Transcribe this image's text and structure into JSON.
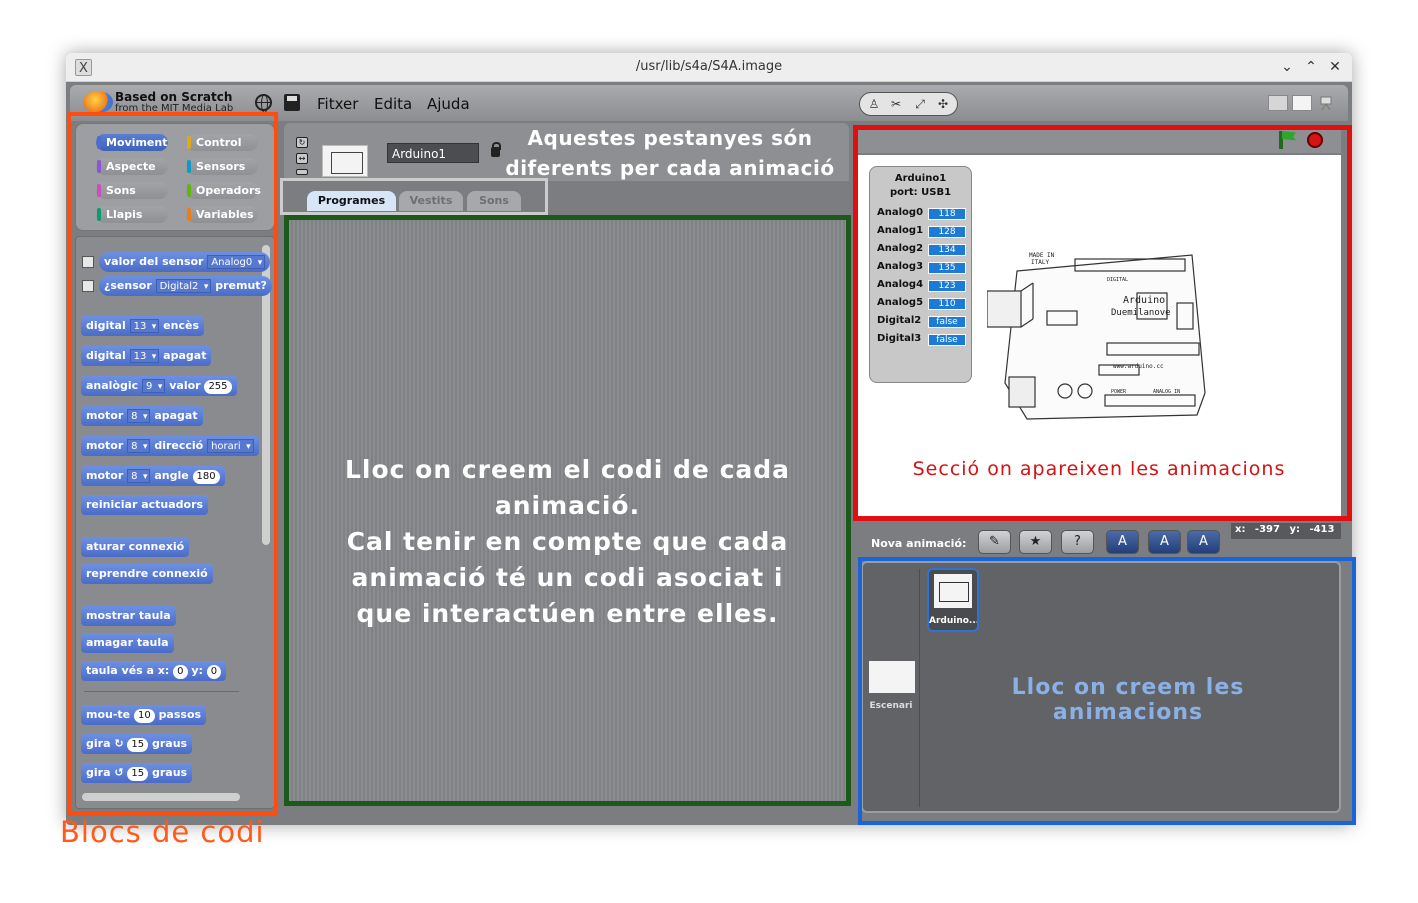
{
  "window": {
    "title": "/usr/lib/s4a/S4A.image",
    "app_icon": "X",
    "controls": [
      "chevron-down-icon",
      "chevron-up-icon",
      "close-icon"
    ]
  },
  "toolbar": {
    "brand_line1": "Based on Scratch",
    "brand_line2": "from the MIT Media Lab",
    "menus": [
      "Fitxer",
      "Edita",
      "Ajuda"
    ]
  },
  "categories": [
    {
      "label": "Moviment",
      "color": "#4a6cd4",
      "selected": true
    },
    {
      "label": "Control",
      "color": "#e1a91a",
      "selected": false
    },
    {
      "label": "Aspecte",
      "color": "#8a55d7",
      "selected": false
    },
    {
      "label": "Sensors",
      "color": "#0e9ac9",
      "selected": false
    },
    {
      "label": "Sons",
      "color": "#c94fc0",
      "selected": false
    },
    {
      "label": "Operadors",
      "color": "#5cb712",
      "selected": false
    },
    {
      "label": "Llapis",
      "color": "#0e9a6c",
      "selected": false
    },
    {
      "label": "Variables",
      "color": "#ee7d16",
      "selected": false
    }
  ],
  "blocks": {
    "sensor_value": {
      "text": "valor del sensor",
      "option": "Analog0"
    },
    "sensor_pressed": {
      "prefix": "¿sensor",
      "option": "Digital2",
      "suffix": "premut?"
    },
    "digital_on": {
      "prefix": "digital",
      "pin": "13",
      "suffix": "encès"
    },
    "digital_off": {
      "prefix": "digital",
      "pin": "13",
      "suffix": "apagat"
    },
    "analog": {
      "prefix": "analògic",
      "pin": "9",
      "mid": "valor",
      "value": "255"
    },
    "motor_off": {
      "prefix": "motor",
      "pin": "8",
      "suffix": "apagat"
    },
    "motor_dir": {
      "prefix": "motor",
      "pin": "8",
      "mid": "direcció",
      "option": "horari"
    },
    "motor_angle": {
      "prefix": "motor",
      "pin": "8",
      "mid": "angle",
      "value": "180"
    },
    "reset": "reiniciar actuadors",
    "stop_conn": "aturar connexió",
    "resume_conn": "reprendre connexió",
    "show_board": "mostrar taula",
    "hide_board": "amagar taula",
    "board_goto": {
      "prefix": "taula vés a x:",
      "x": "0",
      "ymid": "y:",
      "y": "0"
    },
    "move": {
      "prefix": "mou-te",
      "value": "10",
      "suffix": "passos"
    },
    "turn_cw": {
      "prefix": "gira",
      "value": "15",
      "suffix": "graus"
    },
    "turn_ccw": {
      "prefix": "gira",
      "value": "15",
      "suffix": "graus"
    }
  },
  "sprite": {
    "name": "Arduino1"
  },
  "tabs": [
    {
      "label": "Programes",
      "active": true
    },
    {
      "label": "Vestits",
      "active": false
    },
    {
      "label": "Sons",
      "active": false
    }
  ],
  "annotations": {
    "tabs_note_line1": "Aquestes pestanyes són",
    "tabs_note_line2": "diferents per cada animació",
    "scripts_note": [
      "Lloc on creem el codi de cada",
      "animació.",
      "Cal tenir en compte que cada",
      "animació té un codi asociat i",
      "que interactúen entre elles."
    ],
    "stage_note": "Secció on apareixen les animacions",
    "corral_note": "Lloc on creem les animacions",
    "blocks_note": "Blocs de codi"
  },
  "board_watcher": {
    "title_line1": "Arduino1",
    "title_line2": "port: USB1",
    "rows": [
      {
        "label": "Analog0",
        "value": "118"
      },
      {
        "label": "Analog1",
        "value": "128"
      },
      {
        "label": "Analog2",
        "value": "134"
      },
      {
        "label": "Analog3",
        "value": "135"
      },
      {
        "label": "Analog4",
        "value": "123"
      },
      {
        "label": "Analog5",
        "value": "110"
      },
      {
        "label": "Digital2",
        "value": "false"
      },
      {
        "label": "Digital3",
        "value": "false"
      }
    ]
  },
  "board_image": {
    "made_in": "MADE IN",
    "country": "ITALY",
    "digital": "DIGITAL",
    "name_line1": "Arduino",
    "name_line2": "Duemilanove",
    "site": "www.arduino.cc",
    "power": "POWER",
    "analog_in": "ANALOG IN"
  },
  "corral": {
    "new_sprite_label": "Nova animació:",
    "mouse_x": "x: -397",
    "mouse_y": "y: -413",
    "stage_label": "Escenari",
    "sprite_label": "Arduino..."
  },
  "colors": {
    "blocks_box": "#ff4c0f",
    "stage_box": "#e01010",
    "corral_box": "#1b63d8",
    "scripts_border": "#1c5a1c",
    "motion_block": "#4a6cc7"
  }
}
